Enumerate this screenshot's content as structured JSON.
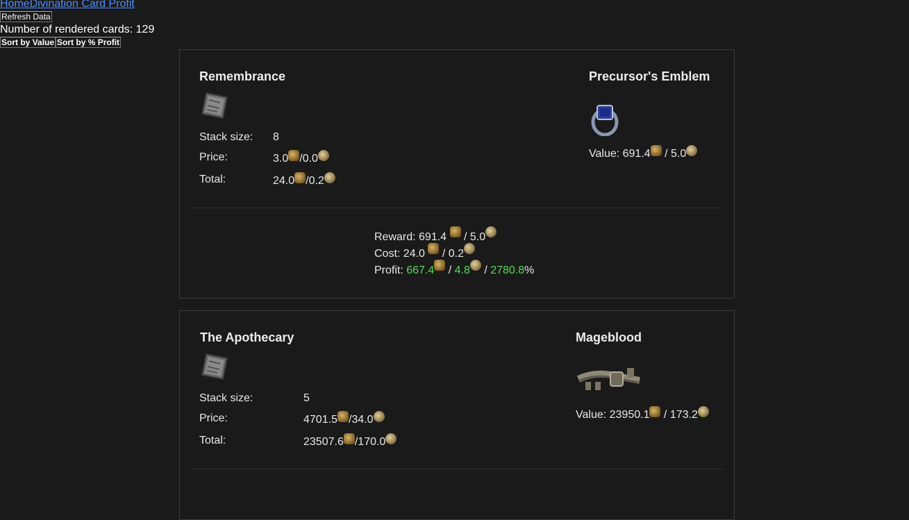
{
  "nav": {
    "home": "Home",
    "divination": "Divination Card Profit"
  },
  "refresh_label": "Refresh Data",
  "count_text": "Number of rendered cards: 129",
  "sort": {
    "by_value": "Sort by Value",
    "by_profit": "Sort by % Profit"
  },
  "labels": {
    "stack": "Stack size:",
    "price": "Price:",
    "total": "Total:",
    "value": "Value: "
  },
  "cards": [
    {
      "card_name": "Remembrance",
      "stack_size": "8",
      "price_chaos": "3.0",
      "price_div": "/0.0",
      "total_chaos": "24.0",
      "total_div": "/0.2",
      "reward_name": "Precursor's Emblem",
      "value_chaos": "691.4",
      "value_div": " / 5.0",
      "summary": {
        "reward_prefix": "Reward: 691.4",
        "reward_div": " / 5.0",
        "cost_prefix": "Cost: 24.0",
        "cost_div": " / 0.2",
        "profit_prefix": "Profit: ",
        "profit_chaos": "667.4",
        "profit_div_sep": " / ",
        "profit_div": "4.8",
        "profit_pct_sep": " / ",
        "profit_pct": "2780.8",
        "pct_sign": "%"
      }
    },
    {
      "card_name": "The Apothecary",
      "stack_size": "5",
      "price_chaos": "4701.5",
      "price_div": "/34.0",
      "total_chaos": "23507.6",
      "total_div": "/170.0",
      "reward_name": "Mageblood",
      "value_chaos": "23950.1",
      "value_div": " / 173.2"
    }
  ],
  "colors": {
    "link": "#4d8cff",
    "profit": "#55dd55",
    "background": "#1a1a1a"
  },
  "icons": [
    "chaos-orb-icon",
    "divine-orb-icon",
    "divination-card-icon",
    "ring-icon",
    "belt-icon"
  ]
}
